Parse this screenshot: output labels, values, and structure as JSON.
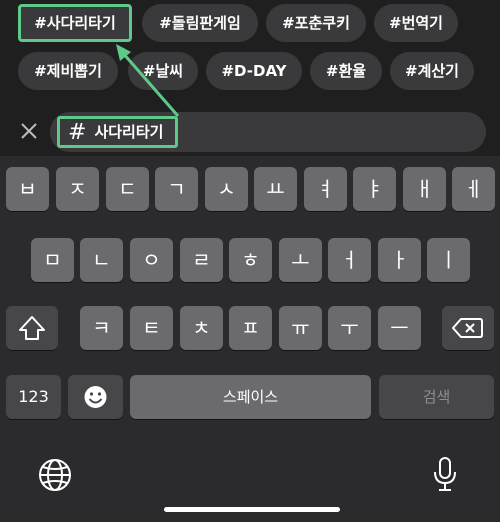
{
  "chips_row1": [
    {
      "label": "#사다리타기",
      "highlighted": true
    },
    {
      "label": "#돌림판게임",
      "highlighted": false
    },
    {
      "label": "#포춘쿠키",
      "highlighted": false
    },
    {
      "label": "#번역기",
      "highlighted": false
    }
  ],
  "chips_row2": [
    {
      "label": "#제비뽑기"
    },
    {
      "label": "#날씨"
    },
    {
      "label": "#D-DAY"
    },
    {
      "label": "#환율"
    },
    {
      "label": "#계산기"
    }
  ],
  "search": {
    "hash": "#",
    "query": "사다리타기"
  },
  "keyboard": {
    "row1": [
      "ㅂ",
      "ㅈ",
      "ㄷ",
      "ㄱ",
      "ㅅ",
      "ㅛ",
      "ㅕ",
      "ㅑ",
      "ㅐ",
      "ㅔ"
    ],
    "row2": [
      "ㅁ",
      "ㄴ",
      "ㅇ",
      "ㄹ",
      "ㅎ",
      "ㅗ",
      "ㅓ",
      "ㅏ",
      "ㅣ"
    ],
    "row3": [
      "ㅋ",
      "ㅌ",
      "ㅊ",
      "ㅍ",
      "ㅠ",
      "ㅜ",
      "ㅡ"
    ],
    "numbers_key": "123",
    "space_key": "스페이스",
    "search_key": "검색"
  },
  "colors": {
    "highlight": "#5fc98a",
    "key": "#6b6b6e",
    "key_dark": "#474749"
  }
}
